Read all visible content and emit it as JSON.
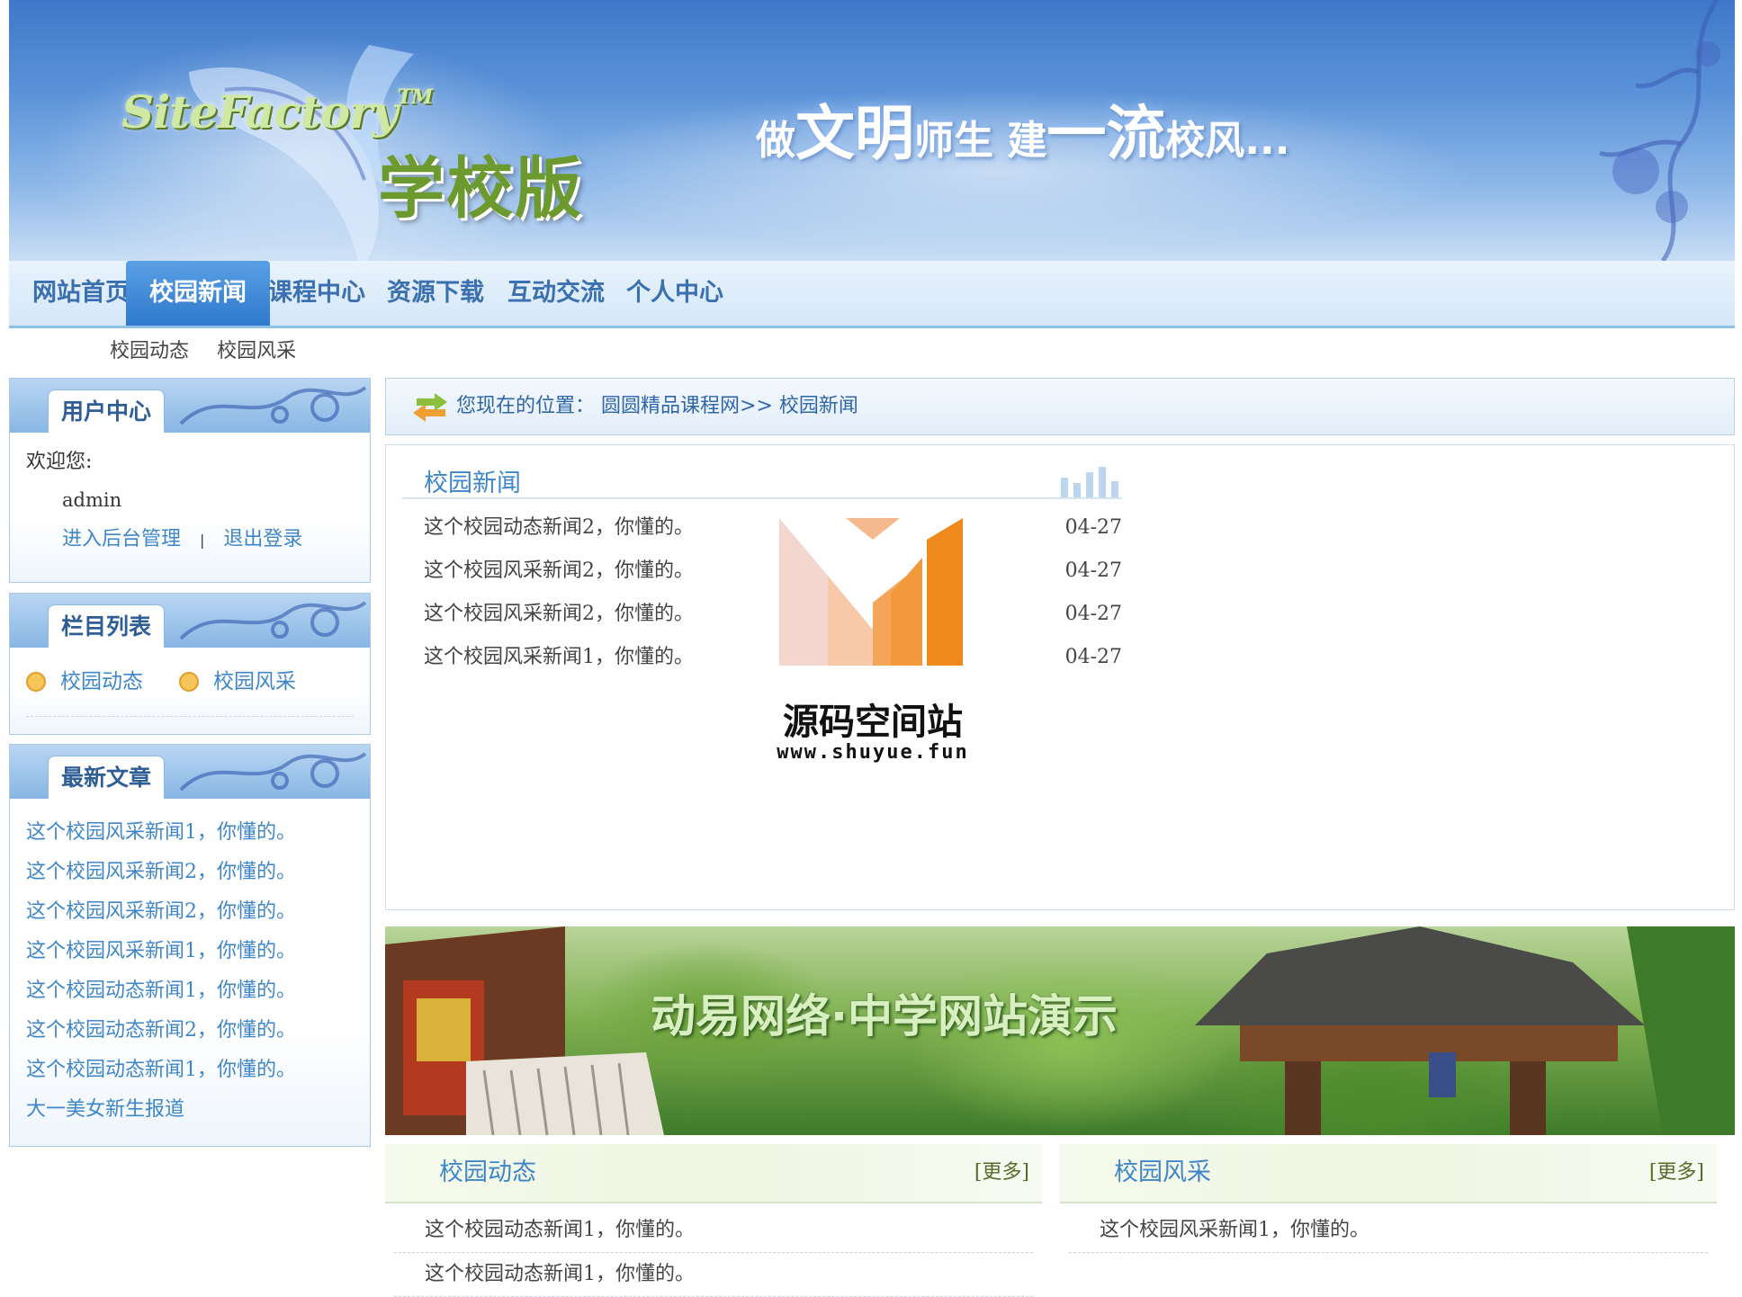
{
  "header": {
    "logo_en": "SiteFactory",
    "logo_tm": "TM",
    "logo_cn": "学校版",
    "slogan": [
      {
        "t": "做",
        "big": false
      },
      {
        "t": "文明",
        "big": true
      },
      {
        "t": "师生  ",
        "big": false
      },
      {
        "t": "建",
        "big": false
      },
      {
        "t": "一流",
        "big": true
      },
      {
        "t": "校风...",
        "big": false
      }
    ]
  },
  "nav": {
    "items": [
      {
        "label": "网站首页",
        "active": false
      },
      {
        "label": "校园新闻",
        "active": true
      },
      {
        "label": "课程中心",
        "active": false
      },
      {
        "label": "资源下载",
        "active": false
      },
      {
        "label": "互动交流",
        "active": false
      },
      {
        "label": "个人中心",
        "active": false
      }
    ]
  },
  "subnav": {
    "items": [
      "校园动态",
      "校园风采"
    ]
  },
  "user_center": {
    "title": "用户中心",
    "welcome": "欢迎您:",
    "username": "admin",
    "admin_link": "进入后台管理",
    "separator": "|",
    "logout_link": "退出登录"
  },
  "categories": {
    "title": "栏目列表",
    "items": [
      "校园动态",
      "校园风采"
    ]
  },
  "latest": {
    "title": "最新文章",
    "items": [
      "这个校园风采新闻1，你懂的。",
      "这个校园风采新闻2，你懂的。",
      "这个校园风采新闻2，你懂的。",
      "这个校园风采新闻1，你懂的。",
      "这个校园动态新闻1，你懂的。",
      "这个校园动态新闻2，你懂的。",
      "这个校园动态新闻1，你懂的。",
      "大一美女新生报道"
    ]
  },
  "breadcrumb": {
    "prefix": "您现在的位置：",
    "site": "圆圆精品课程网",
    "sep": ">>",
    "current": "校园新闻"
  },
  "news": {
    "title": "校园新闻",
    "rows": [
      {
        "title": "这个校园动态新闻2，你懂的。",
        "date": "04-27"
      },
      {
        "title": "这个校园风采新闻2，你懂的。",
        "date": "04-27"
      },
      {
        "title": "这个校园风采新闻2，你懂的。",
        "date": "04-27"
      },
      {
        "title": "这个校园风采新闻1，你懂的。",
        "date": "04-27"
      }
    ]
  },
  "watermark": {
    "name": "源码空间站",
    "url": "www.shuyue.fun"
  },
  "photo_banner": {
    "title": "动易网络·中学网站演示"
  },
  "columns": [
    {
      "title": "校园动态",
      "more": "[更多]",
      "items": [
        "这个校园动态新闻1，你懂的。",
        "这个校园动态新闻1，你懂的。"
      ]
    },
    {
      "title": "校园风采",
      "more": "[更多]",
      "items": [
        "这个校园风采新闻1，你懂的。"
      ]
    }
  ],
  "colors": {
    "accent": "#3f86c8",
    "nav_active": "#2f78cc",
    "title_blue": "#2f5e96",
    "logo_green": "#6c9a2e"
  }
}
